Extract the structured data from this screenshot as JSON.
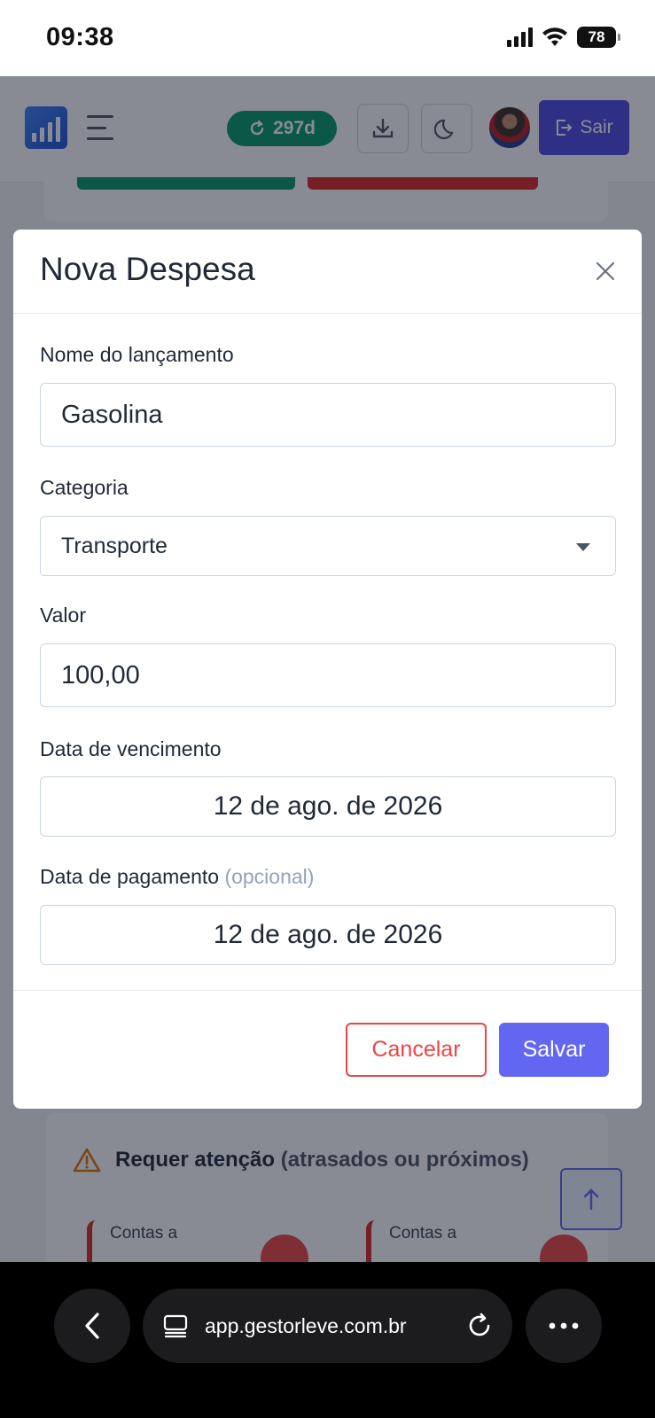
{
  "status_bar": {
    "time": "09:38",
    "battery": "78"
  },
  "header": {
    "days_badge": "297d",
    "logout_label": "Sair"
  },
  "modal": {
    "title": "Nova Despesa",
    "fields": {
      "name": {
        "label": "Nome do lançamento",
        "value": "Gasolina"
      },
      "category": {
        "label": "Categoria",
        "value": "Transporte"
      },
      "amount": {
        "label": "Valor",
        "value": "100,00"
      },
      "due_date": {
        "label": "Data de vencimento",
        "value": "12 de ago. de 2026"
      },
      "payment_date": {
        "label": "Data de pagamento",
        "optional": "(opcional)",
        "value": "12 de ago. de 2026"
      }
    },
    "cancel_label": "Cancelar",
    "save_label": "Salvar"
  },
  "background": {
    "attention_title": "Requer atenção",
    "attention_subtitle": "(atrasados ou próximos)",
    "card_left_label": "Contas a",
    "card_right_label": "Contas a"
  },
  "browser": {
    "url": "app.gestorleve.com.br"
  },
  "colors": {
    "primary": "#6366f1",
    "success": "#059669",
    "danger": "#ef4444",
    "logout": "#4f46e5"
  }
}
